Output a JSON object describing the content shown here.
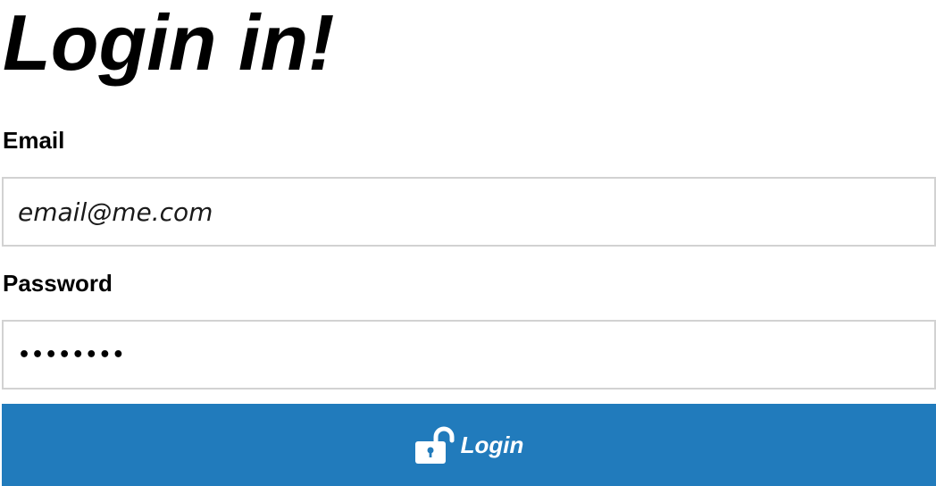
{
  "page": {
    "title": "Login in!"
  },
  "form": {
    "email_label": "Email",
    "email_placeholder": "email@me.com",
    "password_label": "Password",
    "password_value": "••••••••",
    "login_button_label": "Login",
    "login_button_icon": "unlocked-padlock-icon"
  },
  "colors": {
    "button_background": "#217bbc",
    "input_border": "#d2d2d2",
    "text": "#000000"
  }
}
